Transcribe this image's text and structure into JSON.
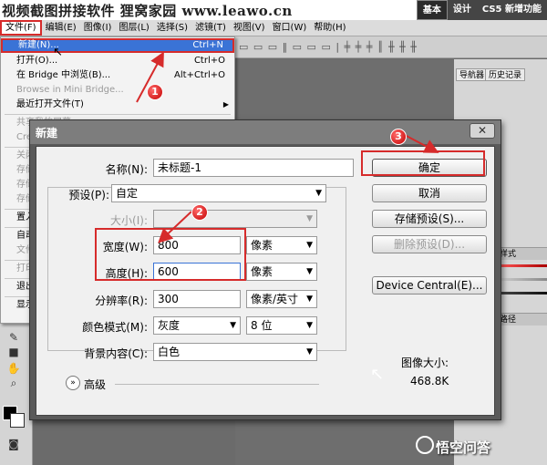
{
  "banner": {
    "text": "视频截图拼接软件 狸窝家园 www.leawo.cn"
  },
  "workspace_tabs": [
    "基本",
    "设计",
    "CS5 新增功能"
  ],
  "menubar": [
    "文件(F)",
    "编辑(E)",
    "图像(I)",
    "图层(L)",
    "选择(S)",
    "滤镜(T)",
    "视图(V)",
    "窗口(W)",
    "帮助(H)"
  ],
  "file_menu": {
    "items": [
      {
        "label": "新建(N)...",
        "shortcut": "Ctrl+N"
      },
      {
        "label": "打开(O)...",
        "shortcut": "Ctrl+O"
      },
      {
        "label": "在 Bridge 中浏览(B)...",
        "shortcut": "Alt+Ctrl+O"
      },
      {
        "label": "Browse in Mini Bridge..."
      },
      {
        "label": "最近打开文件(T)"
      }
    ],
    "truncated": [
      "共享我的屏幕",
      "Cre",
      "关闭",
      "存储",
      "存储",
      "存储",
      "置入",
      "自动",
      "文件",
      "打印",
      "退出",
      "显示"
    ]
  },
  "panel_tabs": [
    "导航器",
    "历史记录"
  ],
  "panel_strips": [
    "样式",
    "路径"
  ],
  "dialog": {
    "title": "新建",
    "close": "✕",
    "fields": {
      "name_label": "名称(N):",
      "name_value": "未标题-1",
      "preset_label": "预设(P):",
      "preset_value": "自定",
      "size_label": "大小(I):",
      "width_label": "宽度(W):",
      "width_value": "800",
      "width_unit": "像素",
      "height_label": "高度(H):",
      "height_value": "600",
      "height_unit": "像素",
      "resolution_label": "分辨率(R):",
      "resolution_value": "300",
      "resolution_unit": "像素/英寸",
      "color_mode_label": "颜色模式(M):",
      "color_mode_value": "灰度",
      "bit_depth": "8 位",
      "background_label": "背景内容(C):",
      "background_value": "白色",
      "advanced_label": "高级"
    },
    "buttons": {
      "ok": "确定",
      "cancel": "取消",
      "save_preset": "存储预设(S)...",
      "delete_preset": "删除预设(D)...",
      "device_central": "Device Central(E)..."
    },
    "image_size_label": "图像大小:",
    "image_size_value": "468.8K"
  },
  "badges": [
    "1",
    "2",
    "3"
  ],
  "watermark": "悟空问答",
  "colors": {
    "highlight_red": "#d62b2b",
    "menu_selection": "#3a73d6"
  }
}
